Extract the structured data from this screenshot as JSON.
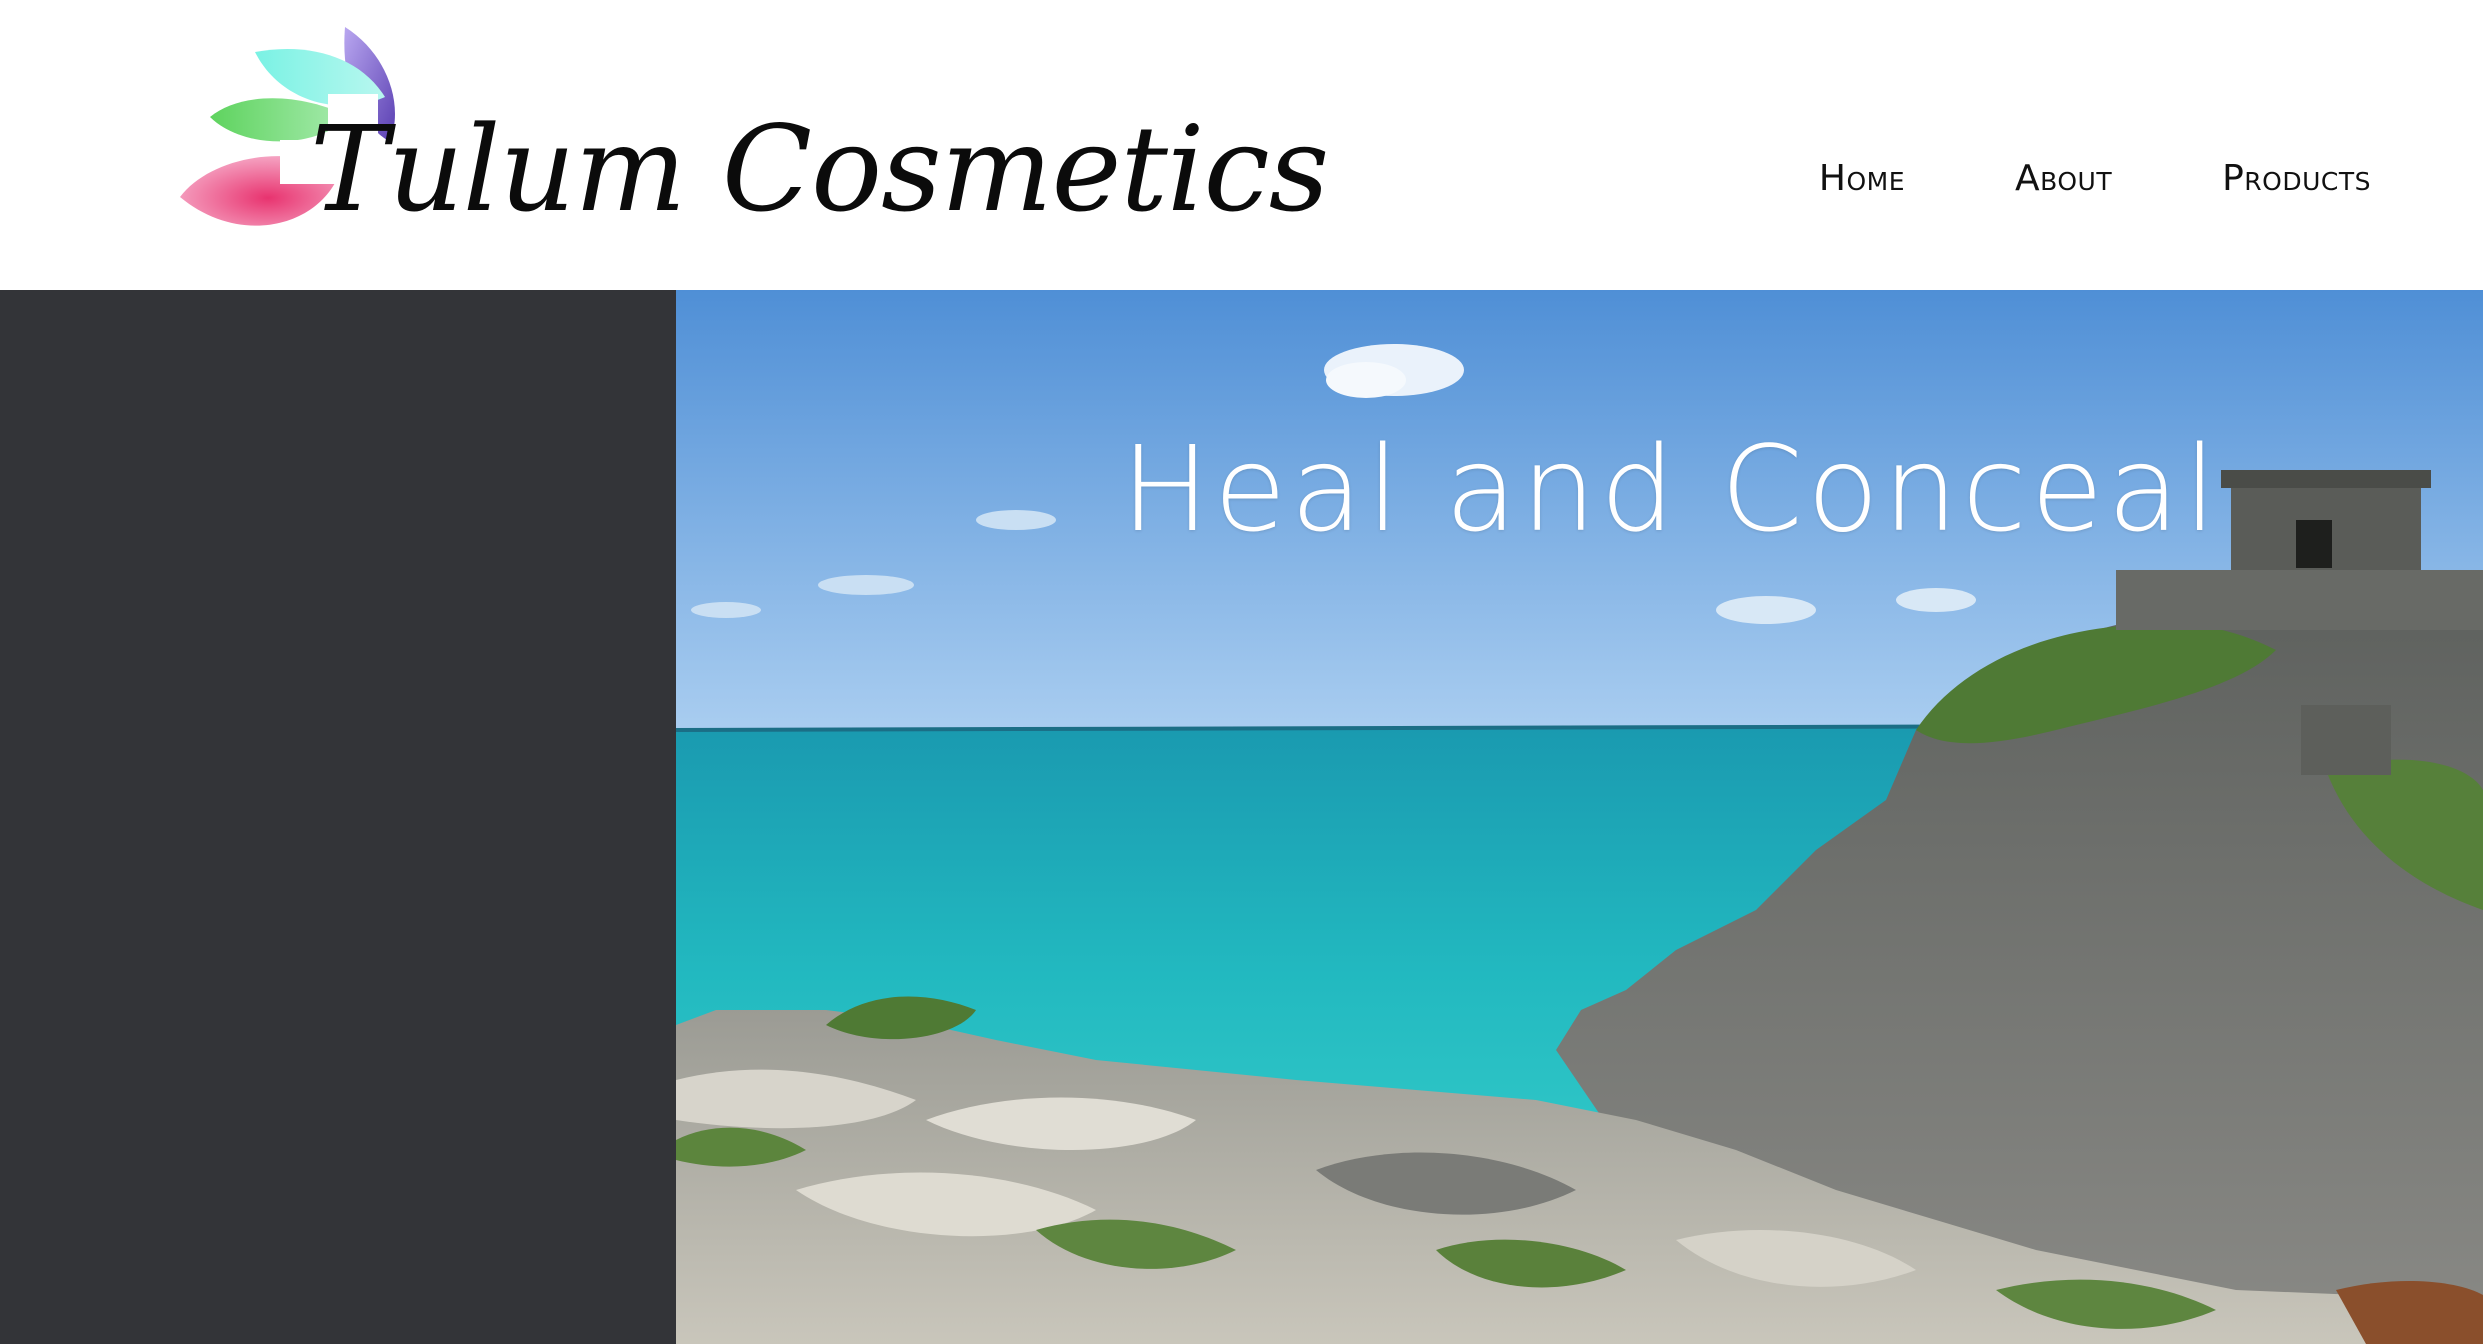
{
  "brand": {
    "name": "Tulum Cosmetics",
    "colors": {
      "teal": "#5ee6d6",
      "purple": "#6a4fc0",
      "green": "#6ad36a",
      "pink": "#ee5a92"
    }
  },
  "nav": {
    "items": [
      {
        "label": "Home"
      },
      {
        "label": "About"
      },
      {
        "label": "Products"
      }
    ]
  },
  "hero": {
    "title": "Heal and Conceal",
    "image_subject": "turquoise sea, rocky coast with ruins",
    "colors": {
      "sky": "#5b9ad8",
      "sea": "#2bc4c4",
      "rock": "#6e6f6c",
      "vegetation": "#5f7d3a"
    }
  },
  "sidebar": {
    "color": "#333438"
  }
}
